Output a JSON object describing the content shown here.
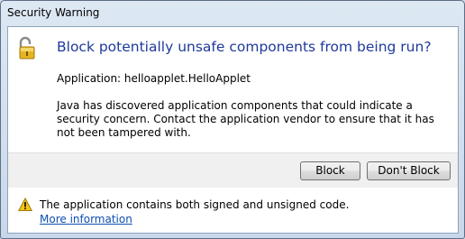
{
  "window": {
    "title": "Security Warning"
  },
  "dialog": {
    "icon": "open-padlock-icon",
    "heading": "Block potentially unsafe components from being run?",
    "application_line": "Application: helloapplet.HelloApplet",
    "description": "Java has discovered application components that could indicate a security concern. Contact the application vendor to ensure that it has not been tampered with."
  },
  "buttons": {
    "block": "Block",
    "dont_block": "Don't Block"
  },
  "footer": {
    "icon": "warning-icon",
    "text": "The application contains both signed and unsigned code.",
    "link": "More information"
  },
  "colors": {
    "heading": "#1e3a9a",
    "link": "#0d4fb3",
    "warning": "#f5c518",
    "lock": "#e6b422"
  }
}
